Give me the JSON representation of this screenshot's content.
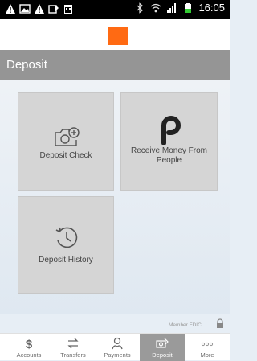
{
  "status_bar": {
    "time": "16:05"
  },
  "header": {
    "title": "Deposit"
  },
  "tiles": [
    {
      "label": "Deposit Check",
      "icon": "camera-plus-icon"
    },
    {
      "label": "Receive Money From People",
      "icon": "p-logo-icon"
    },
    {
      "label": "Deposit History",
      "icon": "history-icon"
    }
  ],
  "footer": {
    "fdic_text": "Member FDIC"
  },
  "nav": {
    "items": [
      {
        "label": "Accounts",
        "icon": "dollar-icon"
      },
      {
        "label": "Transfers",
        "icon": "transfer-icon"
      },
      {
        "label": "Payments",
        "icon": "payments-icon"
      },
      {
        "label": "Deposit",
        "icon": "deposit-icon"
      },
      {
        "label": "More",
        "icon": "more-icon"
      }
    ],
    "active": "Deposit"
  },
  "colors": {
    "brand": "#ff6a13",
    "titlebar": "#959595",
    "tile": "#d5d5d5",
    "active_nav": "#9a9a9a"
  }
}
